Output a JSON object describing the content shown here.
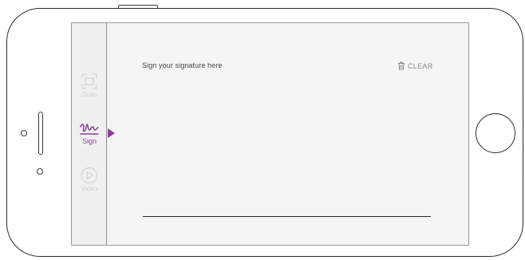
{
  "sidebar": {
    "items": [
      {
        "label": "Scan",
        "icon": "scan-frame-icon",
        "active": false
      },
      {
        "label": "Sign",
        "icon": "signature-icon",
        "active": true
      },
      {
        "label": "Video",
        "icon": "play-circle-icon",
        "active": false
      }
    ]
  },
  "main": {
    "instruction": "Sign your signature here",
    "clear_label": "CLEAR",
    "clear_icon": "trash-icon"
  },
  "colors": {
    "accent": "#8b3e98",
    "inactive": "#cfcfcf",
    "screen_background": "#f5f5f5"
  }
}
